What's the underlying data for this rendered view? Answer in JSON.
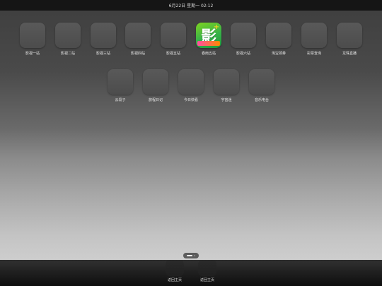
{
  "status_bar": {
    "datetime": "6月22日 星期一 02:12"
  },
  "apps": [
    {
      "label": "影视一站"
    },
    {
      "label": "影视二站"
    },
    {
      "label": "影视三站"
    },
    {
      "label": "影视四站"
    },
    {
      "label": "影视五站"
    },
    {
      "label": "春雨五站",
      "icon": "ying-yingshi-app-icon",
      "glyph": "影",
      "accent": "#36b24a"
    },
    {
      "label": "影视六站"
    },
    {
      "label": "淘宝领券"
    },
    {
      "label": "彩票查询"
    },
    {
      "label": "龙珠直播"
    },
    {
      "label": "云段子"
    },
    {
      "label": "旅程日记"
    },
    {
      "label": "今日快看"
    },
    {
      "label": "宇宙迷"
    },
    {
      "label": "音乐电台"
    }
  ],
  "page_indicator": {
    "current": 1,
    "total": 2
  },
  "dock": [
    {
      "label": "返回主页"
    },
    {
      "label": "返回主页"
    }
  ]
}
